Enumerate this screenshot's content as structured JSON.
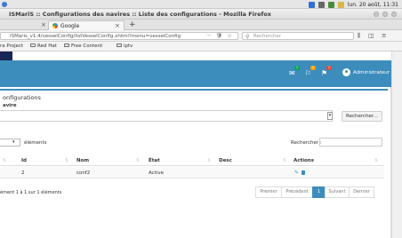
{
  "os_panel": {
    "clock": "lun. 20 août, 11:31"
  },
  "window": {
    "title": "ISMariS :: Configurations des navires :: Liste des configurations - Mozilla Firefox"
  },
  "tabs": {
    "active_label": "Google",
    "new_tab_symbol": "+"
  },
  "navbar": {
    "url": "ISMaris_v1.4/vesselConfig/listVesselConfig.xhtml?menu=vesselConfig",
    "url_actions": [
      "···",
      "🛡",
      "☆"
    ],
    "search_placeholder": "Rechercher",
    "search_icon": "search-icon"
  },
  "bookmarks": [
    "Red Hat",
    "Free Content",
    "iptv"
  ],
  "bookmarks_prefix": "ra Project",
  "app_header": {
    "badges": [
      "1",
      "4",
      "1"
    ],
    "badge_colors": [
      "#00a65a",
      "#f39c12",
      "#dd4b39"
    ],
    "user_name": "Administrateur"
  },
  "page": {
    "title": "onfigurations",
    "field_label": "avire",
    "search_button": "Rechercher..."
  },
  "table_controls": {
    "length_suffix": "éléments",
    "filter_label": "Rechercher :"
  },
  "table": {
    "columns": [
      "Id",
      "Nom",
      "État",
      "Desc",
      "Actions"
    ],
    "rows": [
      {
        "id": "2",
        "nom": "conf2",
        "etat": "Active",
        "desc": ""
      }
    ]
  },
  "footer": {
    "info": "ément 1 à 1 sur 1 éléments",
    "pagination": [
      "Premier",
      "Précédent",
      "1",
      "Suivant",
      "Dernier"
    ]
  }
}
